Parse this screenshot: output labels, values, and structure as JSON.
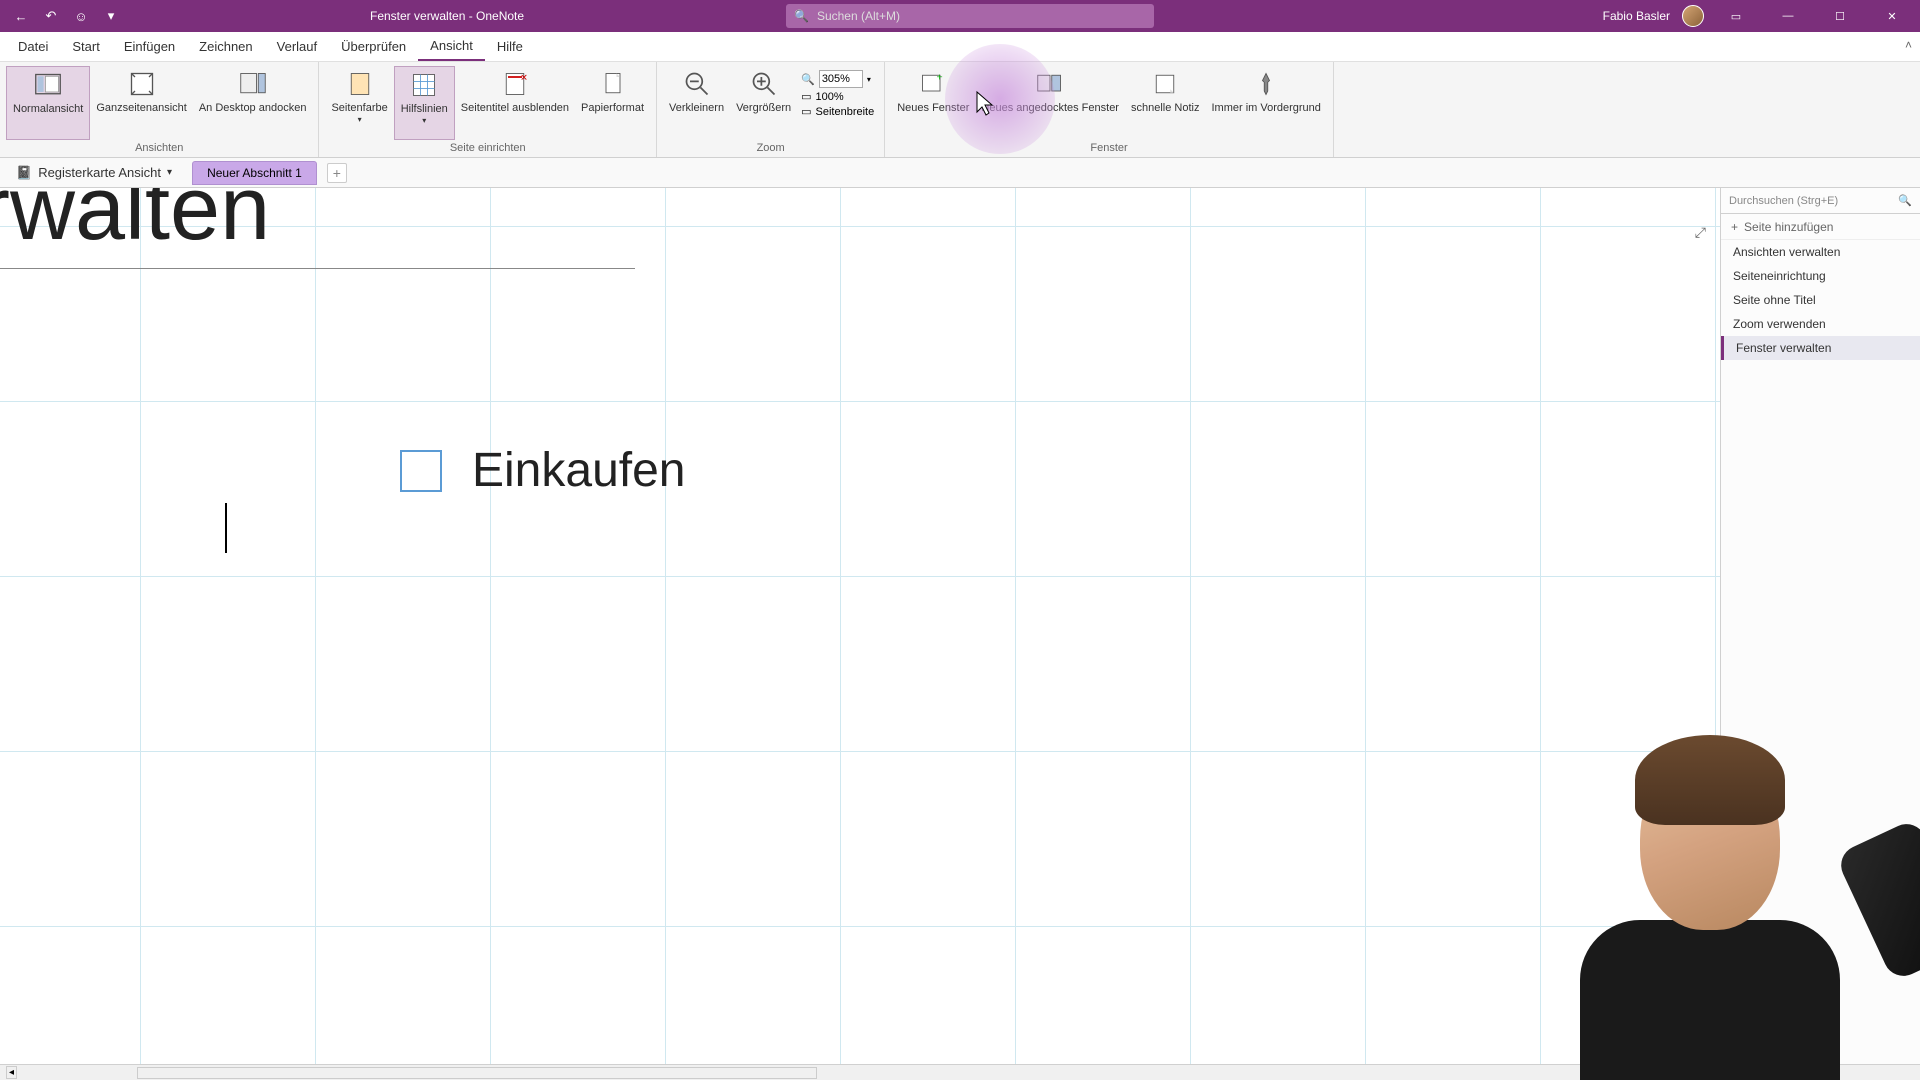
{
  "titlebar": {
    "document": "Fenster verwalten",
    "app": "OneNote",
    "full_title": "Fenster verwalten  -  OneNote",
    "search_placeholder": "Suchen (Alt+M)",
    "user": "Fabio Basler"
  },
  "menu": {
    "tabs": [
      "Datei",
      "Start",
      "Einfügen",
      "Zeichnen",
      "Verlauf",
      "Überprüfen",
      "Ansicht",
      "Hilfe"
    ],
    "active_index": 6
  },
  "ribbon": {
    "groups": {
      "ansichten": {
        "label": "Ansichten",
        "normalansicht": "Normalansicht",
        "ganzseitenansicht": "Ganzseitenansicht",
        "an_desktop": "An Desktop andocken"
      },
      "seite": {
        "label": "Seite einrichten",
        "seitenfarbe": "Seitenfarbe",
        "hilfslinien": "Hilfslinien",
        "seitentitel": "Seitentitel ausblenden",
        "papierformat": "Papierformat"
      },
      "zoom": {
        "label": "Zoom",
        "verkleinern": "Verkleinern",
        "vergroessern": "Vergrößern",
        "percent": "305%",
        "hundred": "100%",
        "seitenbreite": "Seitenbreite"
      },
      "fenster": {
        "label": "Fenster",
        "neues_fenster": "Neues Fenster",
        "neues_angedocktes": "Neues angedocktes Fenster",
        "schnelle_notiz": "schnelle Notiz",
        "immer_im": "Immer im Vordergrund"
      }
    }
  },
  "sectionbar": {
    "notebook": "Registerkarte Ansicht",
    "section": "Neuer Abschnitt 1"
  },
  "canvas": {
    "title": "r verwalten",
    "checkbox_text": "Einkaufen"
  },
  "rightpanel": {
    "search_placeholder": "Durchsuchen (Strg+E)",
    "add_page": "Seite hinzufügen",
    "pages": [
      "Ansichten verwalten",
      "Seiteneinrichtung",
      "Seite ohne Titel",
      "Zoom verwenden",
      "Fenster verwalten"
    ],
    "selected_index": 4
  }
}
